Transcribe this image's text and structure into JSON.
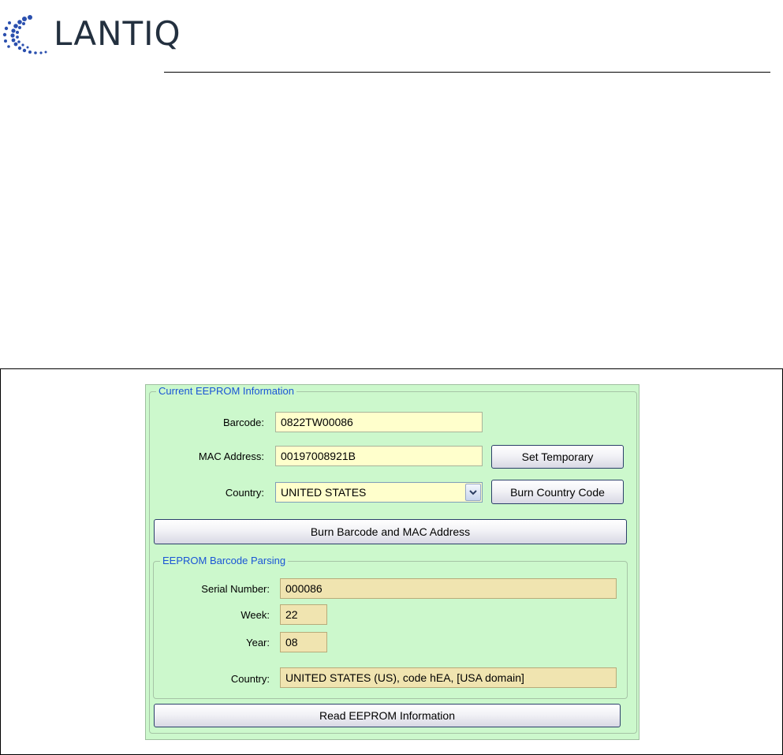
{
  "brand": {
    "name": "Lantiq",
    "logo_text": "LANTIQ"
  },
  "colors": {
    "panel_bg": "#ccf8cc",
    "group_title": "#1a55d6",
    "editable_bg": "#ffffcc",
    "readonly_bg": "#f0e4b0"
  },
  "current_eeprom": {
    "title": "Current EEPROM Information",
    "barcode_label": "Barcode:",
    "barcode_value": "0822TW00086",
    "mac_label": "MAC Address:",
    "mac_value": "00197008921B",
    "country_label": "Country:",
    "country_value": "UNITED STATES",
    "set_temporary_button": "Set Temporary",
    "burn_country_button": "Burn Country Code",
    "burn_barcode_mac_button": "Burn Barcode and MAC Address"
  },
  "barcode_parsing": {
    "title": "EEPROM Barcode Parsing",
    "serial_label": "Serial Number:",
    "serial_value": "000086",
    "week_label": "Week:",
    "week_value": "22",
    "year_label": "Year:",
    "year_value": "08",
    "country_label": "Country:",
    "country_value": "UNITED STATES (US), code hEA, [USA domain]"
  },
  "read_eeprom_button": "Read EEPROM Information",
  "icons": {
    "logo": "lantiq-logo-icon",
    "dropdown": "chevron-down-icon"
  }
}
